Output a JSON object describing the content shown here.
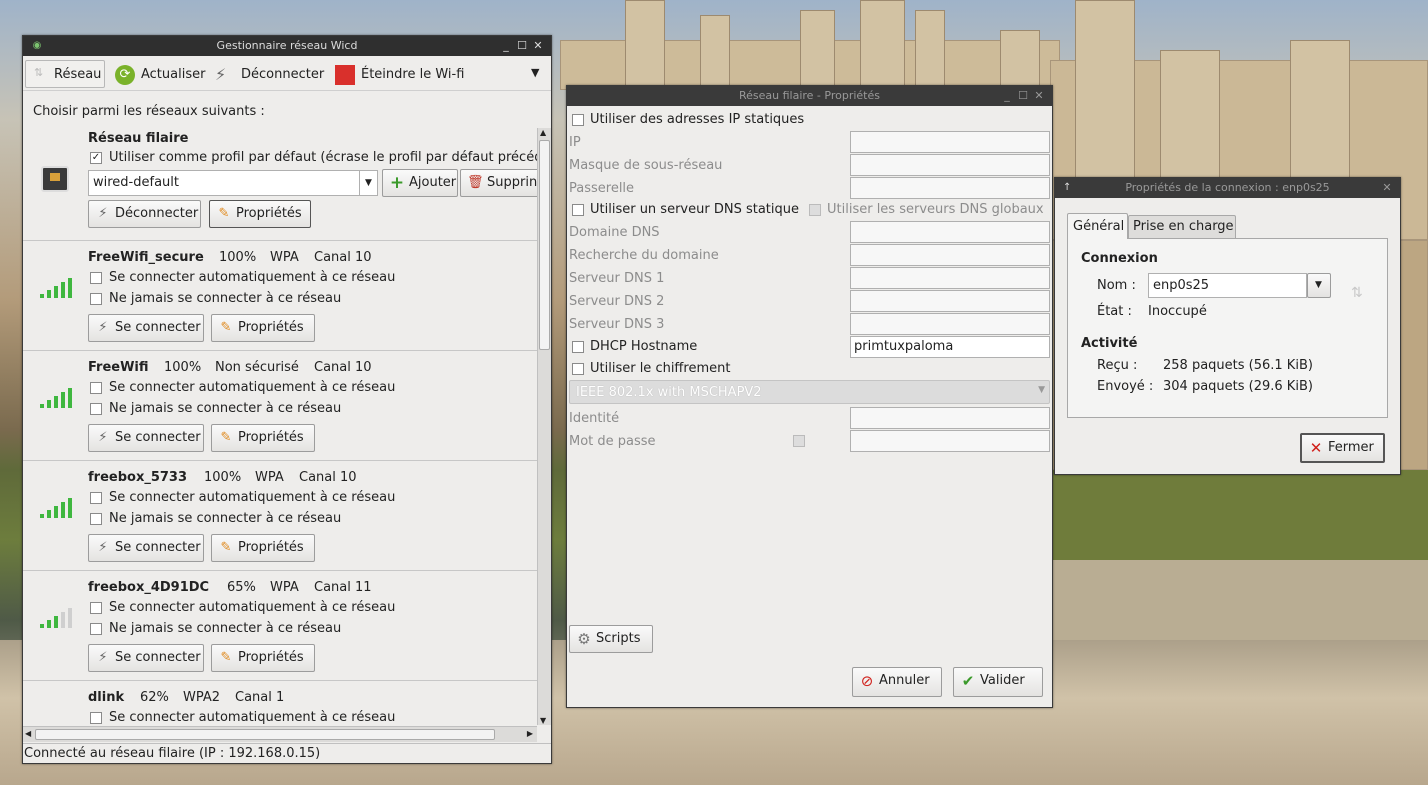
{
  "wicd": {
    "title": "Gestionnaire réseau Wicd",
    "toolbar": {
      "reseau": "Réseau",
      "actualiser": "Actualiser",
      "deconnecter": "Déconnecter",
      "eteindre": "Éteindre le Wi-fi"
    },
    "choose_label": "Choisir parmi les réseaux suivants :",
    "wired": {
      "title": "Réseau filaire",
      "default_profile": "Utiliser comme profil par défaut (écrase le profil par défaut précéde",
      "profile": "wired-default",
      "add": "Ajouter",
      "delete": "Supprin",
      "disconnect": "Déconnecter",
      "properties": "Propriétés"
    },
    "networks": [
      {
        "name": "FreeWifi_secure",
        "strength": "100%",
        "security": "WPA",
        "channel": "Canal 10",
        "level": 1.0
      },
      {
        "name": "FreeWifi",
        "strength": "100%",
        "security": "Non sécurisé",
        "channel": "Canal 10",
        "level": 1.0
      },
      {
        "name": "freebox_5733",
        "strength": "100%",
        "security": "WPA",
        "channel": "Canal 10",
        "level": 1.0
      },
      {
        "name": "freebox_4D91DC",
        "strength": "65%",
        "security": "WPA",
        "channel": "Canal 11",
        "level": 0.65
      },
      {
        "name": "dlink",
        "strength": "62%",
        "security": "WPA2",
        "channel": "Canal 1",
        "level": 0.62
      }
    ],
    "network_labels": {
      "auto": "Se connecter automatiquement à ce réseau",
      "never": "Ne jamais se connecter à ce réseau",
      "connect": "Se connecter",
      "properties": "Propriétés"
    },
    "status": "Connecté au réseau filaire (IP : 192.168.0.15)"
  },
  "wired_props": {
    "title": "Réseau filaire - Propriétés",
    "static_ip": "Utiliser des adresses IP statiques",
    "ip": "IP",
    "netmask": "Masque de sous-réseau",
    "gateway": "Passerelle",
    "static_dns": "Utiliser un serveur DNS statique",
    "global_dns": "Utiliser les serveurs DNS globaux",
    "dns_domain": "Domaine DNS",
    "search_domain": "Recherche du domaine",
    "dns1": "Serveur DNS 1",
    "dns2": "Serveur DNS 2",
    "dns3": "Serveur DNS 3",
    "dhcp_hostname": "DHCP Hostname",
    "dhcp_hostname_value": "primtuxpaloma",
    "encryption": "Utiliser le chiffrement",
    "encryption_method": "IEEE 802.1x with MSCHAPV2",
    "identity": "Identité",
    "password": "Mot de passe",
    "scripts": "Scripts",
    "cancel": "Annuler",
    "ok": "Valider"
  },
  "conn_props": {
    "title": "Propriétés de la connexion : enp0s25",
    "tab_general": "Général",
    "tab_support": "Prise en charge",
    "connexion": "Connexion",
    "nom_label": "Nom :",
    "nom_value": "enp0s25",
    "etat_label": "État :",
    "etat_value": "Inoccupé",
    "activite": "Activité",
    "recu_label": "Reçu :",
    "recu_value": "258 paquets (56.1 KiB)",
    "envoye_label": "Envoyé :",
    "envoye_value": "304 paquets (29.6 KiB)",
    "close": "Fermer"
  }
}
